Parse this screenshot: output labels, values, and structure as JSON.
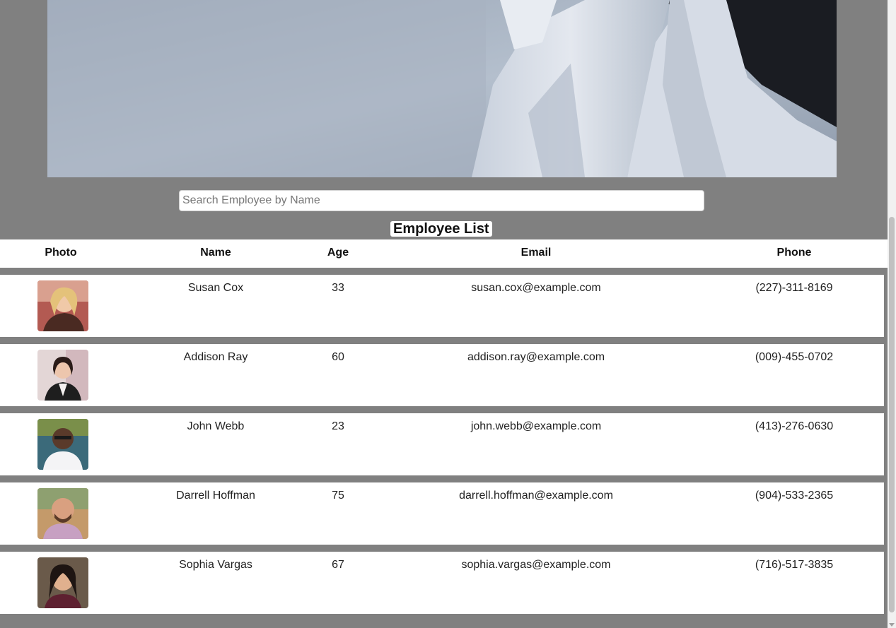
{
  "search": {
    "placeholder": "Search Employee by Name",
    "value": ""
  },
  "list_title": "Employee List",
  "columns": {
    "photo": "Photo",
    "name": "Name",
    "age": "Age",
    "email": "Email",
    "phone": "Phone"
  },
  "employees": [
    {
      "name": "Susan Cox",
      "age": "33",
      "email": "susan.cox@example.com",
      "phone": "(227)-311-8169",
      "photo_icon": "portrait-photo-icon"
    },
    {
      "name": "Addison Ray",
      "age": "60",
      "email": "addison.ray@example.com",
      "phone": "(009)-455-0702",
      "photo_icon": "portrait-photo-icon"
    },
    {
      "name": "John Webb",
      "age": "23",
      "email": "john.webb@example.com",
      "phone": "(413)-276-0630",
      "photo_icon": "portrait-photo-icon"
    },
    {
      "name": "Darrell Hoffman",
      "age": "75",
      "email": "darrell.hoffman@example.com",
      "phone": "(904)-533-2365",
      "photo_icon": "portrait-photo-icon"
    },
    {
      "name": "Sophia Vargas",
      "age": "67",
      "email": "sophia.vargas@example.com",
      "phone": "(716)-517-3835",
      "photo_icon": "portrait-photo-icon"
    }
  ],
  "colors": {
    "page_background": "#808080",
    "row_background": "#ffffff",
    "text": "#222222"
  }
}
